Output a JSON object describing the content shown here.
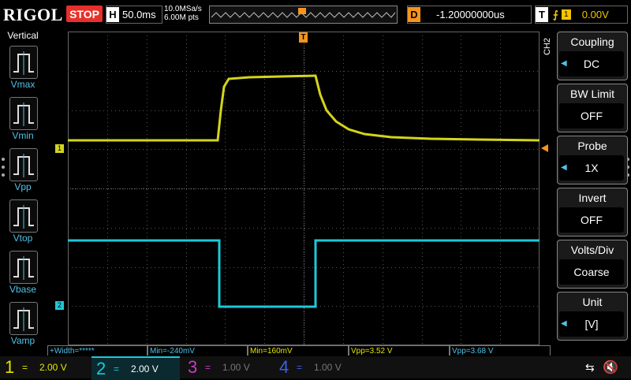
{
  "header": {
    "brand": "RIGOL",
    "run_state": "STOP",
    "timebase_label": "H",
    "timebase": "50.0ms",
    "sample_rate": "10.0MSa/s",
    "memory_depth": "6.00M pts",
    "delay_label": "D",
    "delay": "-1.20000000us",
    "trigger_label": "T",
    "trigger_source": "1",
    "trigger_level": "0.00V"
  },
  "vertical_menu": {
    "title": "Vertical",
    "items": [
      {
        "label": "Vmax",
        "icon": "vmax-icon"
      },
      {
        "label": "Vmin",
        "icon": "vmin-icon"
      },
      {
        "label": "Vpp",
        "icon": "vpp-icon"
      },
      {
        "label": "Vtop",
        "icon": "vtop-icon"
      },
      {
        "label": "Vbase",
        "icon": "vbase-icon"
      },
      {
        "label": "Vamp",
        "icon": "vamp-icon"
      }
    ]
  },
  "channel_menu": {
    "channel_tag": "CH2",
    "items": [
      {
        "title": "Coupling",
        "value": "DC",
        "has_arrow": true
      },
      {
        "title": "BW Limit",
        "value": "OFF",
        "has_arrow": false
      },
      {
        "title": "Probe",
        "value": "1X",
        "has_arrow": true
      },
      {
        "title": "Invert",
        "value": "OFF",
        "has_arrow": false
      },
      {
        "title": "Volts/Div",
        "value": "Coarse",
        "has_arrow": false
      },
      {
        "title": "Unit",
        "value": "[V]",
        "has_arrow": true
      }
    ]
  },
  "measurements": [
    {
      "text": "+Width=*****",
      "color": "#4fc3e8"
    },
    {
      "text": "Min=-240mV",
      "color": "#4fc3e8"
    },
    {
      "text": "Min=160mV",
      "color": "#e6e600"
    },
    {
      "text": "Vpp=3.52 V",
      "color": "#e6e600"
    },
    {
      "text": "Vpp=3.68 V",
      "color": "#4fc3e8"
    }
  ],
  "channels": [
    {
      "num": "1",
      "coupling": "=",
      "scale": "2.00 V",
      "color": "#e6e600",
      "active": false
    },
    {
      "num": "2",
      "coupling": "=",
      "scale": "2.00 V",
      "color": "#1ec8d8",
      "active": true
    },
    {
      "num": "3",
      "coupling": "=",
      "scale": "1.00 V",
      "color": "#c040c0",
      "active": false
    },
    {
      "num": "4",
      "coupling": "=",
      "scale": "1.00 V",
      "color": "#4060e0",
      "active": false
    }
  ],
  "markers": {
    "ch1_marker": "1",
    "ch2_marker": "2",
    "trigger_marker": "T"
  },
  "colors": {
    "ch1": "#d4d41c",
    "ch2": "#1ec8d8",
    "trigger": "#f7941d",
    "stop": "#e8302a"
  }
}
